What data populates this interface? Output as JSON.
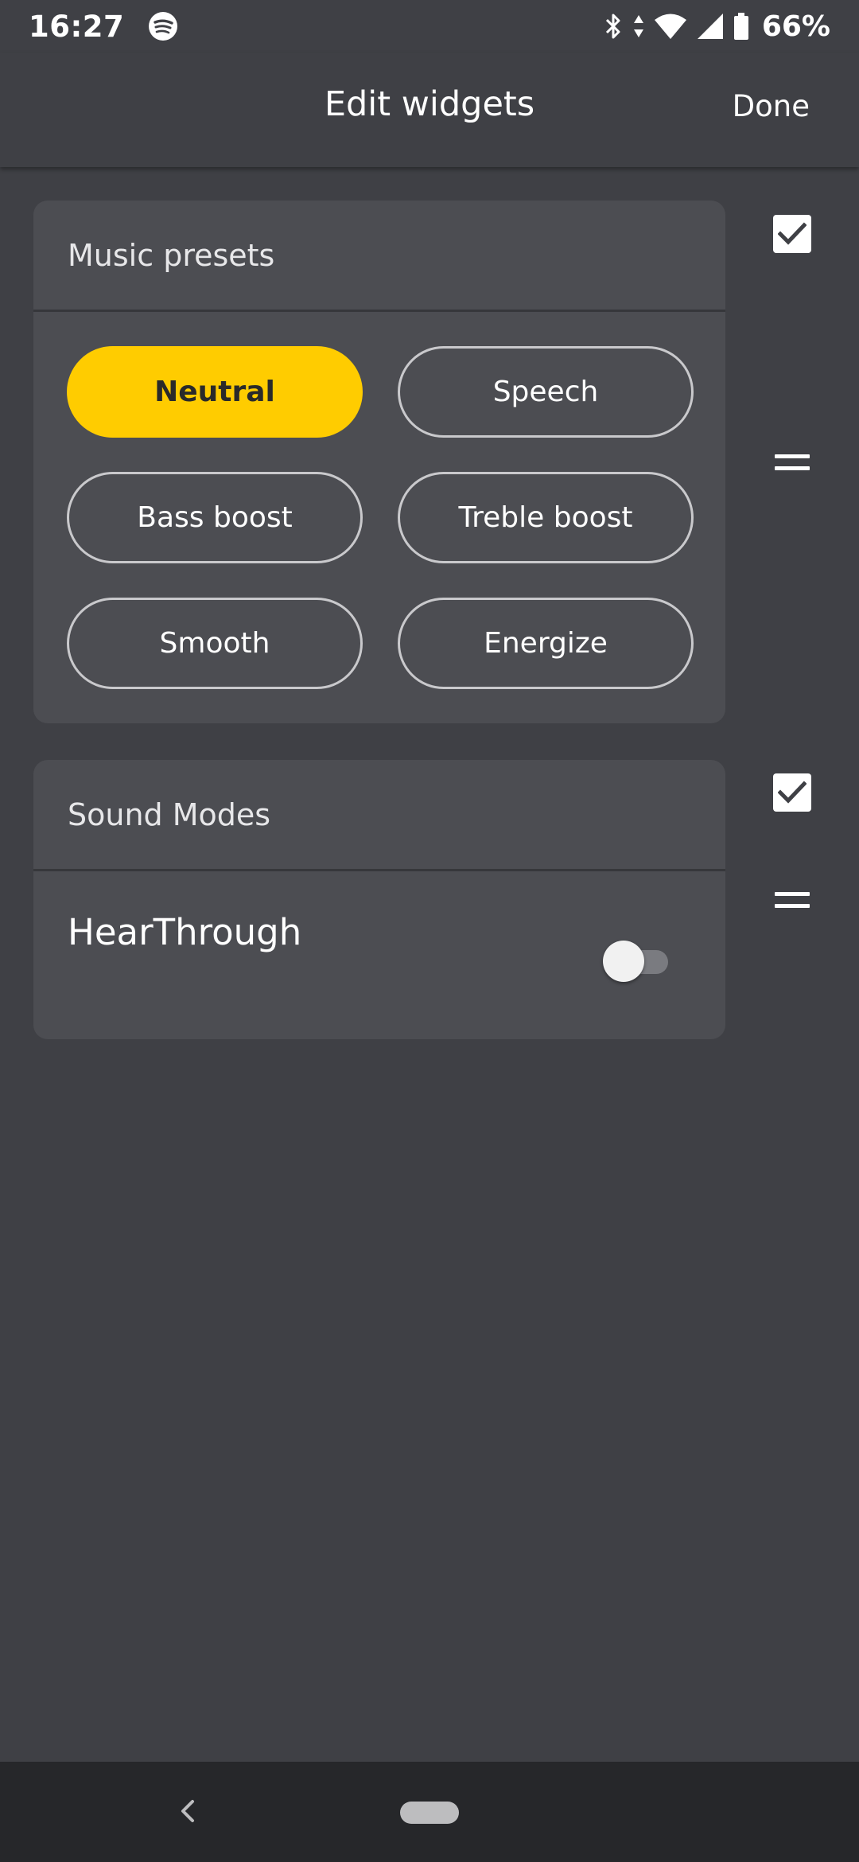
{
  "status_bar": {
    "time": "16:27",
    "battery": "66%",
    "icons": [
      "spotify-icon",
      "bluetooth-icon",
      "data-arrows-icon",
      "wifi-icon",
      "signal-icon",
      "battery-icon"
    ]
  },
  "header": {
    "title": "Edit widgets",
    "done_label": "Done"
  },
  "widgets": {
    "music_presets": {
      "title": "Music presets",
      "checked": true,
      "presets": [
        {
          "label": "Neutral",
          "active": true
        },
        {
          "label": "Speech",
          "active": false
        },
        {
          "label": "Bass boost",
          "active": false
        },
        {
          "label": "Treble boost",
          "active": false
        },
        {
          "label": "Smooth",
          "active": false
        },
        {
          "label": "Energize",
          "active": false
        }
      ]
    },
    "sound_modes": {
      "title": "Sound Modes",
      "checked": true,
      "mode_label": "HearThrough",
      "hearthrough_on": false
    }
  },
  "colors": {
    "background": "#3f4045",
    "card": "#4c4d52",
    "accent": "#ffcc00",
    "nav_bar": "#26272a"
  }
}
